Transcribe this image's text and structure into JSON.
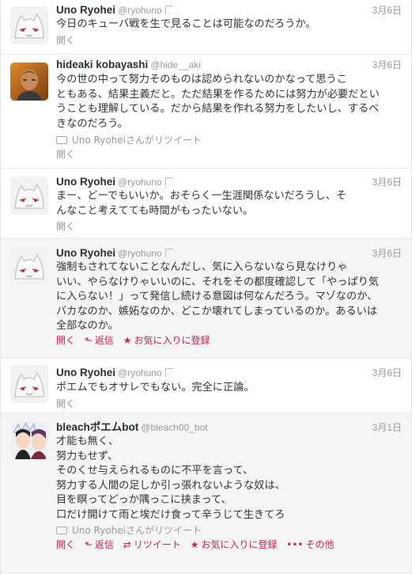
{
  "colors": {
    "name": "#292f33",
    "muted": "#999999",
    "action_accent": "#c8234b",
    "hover_background": "#f5f5f5",
    "divider": "#e1e8ed"
  },
  "tweets": [
    {
      "name": "Uno Ryohei",
      "handle": "@ryohuno",
      "time": "3月6日",
      "text": "今日のキューバ戦を生で見ることは可能なのだろうか。",
      "avatar_icon": "ghost-cat-icon",
      "open_label": "開く"
    },
    {
      "name": "hideaki kobayashi",
      "handle": "@hide__aki",
      "time": "3月6日",
      "text": "今の世の中って努力そのものは認められないのかなって思うこ\nともある、結果主義だと。ただ結果を作るためには努力が必要だとい\nうことも理解している。だから結果を作れる努力をしたいし、するべ\nきなのだろう。",
      "avatar_icon": "person-photo-icon",
      "retweeted_by": "Uno Ryoheiさんがリツイート",
      "open_label": "開く"
    },
    {
      "name": "Uno Ryohei",
      "handle": "@ryohuno",
      "time": "3月6日",
      "text": "まー、どーでもいいか。おそらく一生涯関係ないだろうし、そ\nんなこと考えてても時間がもったいない。",
      "avatar_icon": "ghost-cat-icon",
      "open_label": "開く"
    },
    {
      "name": "Uno Ryohei",
      "handle": "@ryohuno",
      "time": "3月6日",
      "text": "強制もされてないことなんだし、気に入らないなら見なけりゃ\nいい、やらなけりゃいいのに、それをその都度確認して「やっぱり気\nに入らない！」って発信し続ける意図は何なんだろう。マゾなのか、\nバカなのか、嫉妬なのか、どこか壊れてしまっているのか。あるいは\n全部なのか。",
      "avatar_icon": "ghost-cat-icon",
      "open_label": "開く",
      "reply_label": "返信",
      "favorite_label": "お気に入りに登録"
    },
    {
      "name": "Uno Ryohei",
      "handle": "@ryohuno",
      "time": "3月6日",
      "text": "ポエムでもオサレでもない。完全に正論。",
      "avatar_icon": "ghost-cat-icon",
      "open_label": "開く"
    },
    {
      "name": "bleachポエムbot",
      "handle": "@bleach00_bot",
      "time": "3月1日",
      "text": "才能も無く、\n努力もせず、\nそのくせ与えられるものに不平を言って、\n努力する人間の足しか引っ張れないような奴は、\n目を瞑ってどっか隅っこに挟まって、\n口だけ開けて雨と埃だけ食って辛うじて生きてろ",
      "avatar_icon": "anime-character-icon",
      "retweeted_by": "Uno Ryoheiさんがリツイート",
      "open_label": "開く",
      "reply_label": "返信",
      "retweet_label": "リツイート",
      "favorite_label": "お気に入りに登録",
      "more_label": "その他"
    }
  ]
}
